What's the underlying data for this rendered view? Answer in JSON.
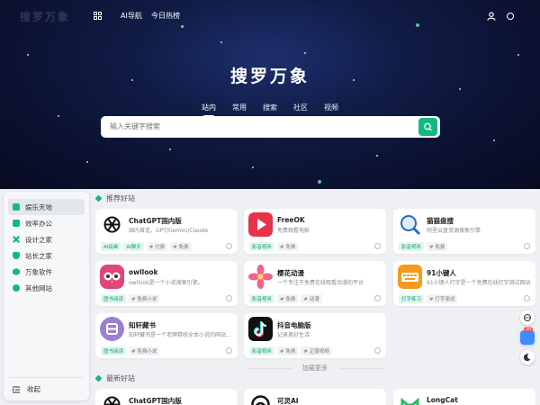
{
  "header": {
    "logo_text": "搜罗万象",
    "nav": [
      "AI导航",
      "今日热榜"
    ]
  },
  "hero": {
    "title": "搜罗万象",
    "tabs": [
      "站内",
      "常用",
      "搜索",
      "社区",
      "视频"
    ],
    "active_tab": "站内",
    "search_placeholder": "输入关键字搜索"
  },
  "sidebar": {
    "items": [
      {
        "label": "娱乐天地",
        "icon": "gamepad-icon",
        "color": "#14b882"
      },
      {
        "label": "效率办公",
        "icon": "briefcase-icon",
        "color": "#14b882"
      },
      {
        "label": "设计之家",
        "icon": "pen-icon",
        "color": "#14b882"
      },
      {
        "label": "站长之家",
        "icon": "shield-icon",
        "color": "#14b882"
      },
      {
        "label": "万象软件",
        "icon": "box-icon",
        "color": "#14b882"
      },
      {
        "label": "其他网站",
        "icon": "more-icon",
        "color": "#14b882"
      }
    ],
    "collapse_label": "收起"
  },
  "recommended": {
    "title": "推荐好站",
    "cards": [
      {
        "name": "ChatGPT国内版",
        "desc": "国内首连，GPT/Gemini/Claude",
        "tags": [
          [
            "AI绘画",
            "green"
          ],
          [
            "AI聊天",
            "green"
          ],
          [
            "# 付费",
            "gray"
          ],
          [
            "# 免费",
            "gray"
          ]
        ],
        "logo": "openai"
      },
      {
        "name": "FreeOK",
        "desc": "免费观看电影",
        "tags": [
          [
            "影音视听",
            "green"
          ],
          [
            "# 免费",
            "gray"
          ]
        ],
        "logo": "freeok"
      },
      {
        "name": "猫猫盘搜",
        "desc": "阿里云盘资源搜索引擎",
        "tags": [
          [
            "影音视听",
            "green"
          ],
          [
            "# 免费",
            "gray"
          ]
        ],
        "logo": "search"
      },
      {
        "name": "owllook",
        "desc": "owllook是一个小说搜索引擎。",
        "tags": [
          [
            "图书阅读",
            "green"
          ],
          [
            "# 免费小说",
            "gray"
          ]
        ],
        "logo": "owl"
      },
      {
        "name": "樱花动漫",
        "desc": "一个专注于免费在线观看动漫的平台",
        "tags": [
          [
            "影音视听",
            "green"
          ],
          [
            "# 免费",
            "gray"
          ],
          [
            "# 动漫",
            "gray"
          ]
        ],
        "logo": "sakura"
      },
      {
        "name": "91小键人",
        "desc": "91小键人打字是一个免费在线打字测试网站...",
        "tags": [
          [
            "打字练习",
            "green"
          ],
          [
            "# 打字测试",
            "gray"
          ]
        ],
        "logo": "typing"
      },
      {
        "name": "知轩藏书",
        "desc": "知轩藏书是一个老牌精校全本小说的网站...",
        "tags": [
          [
            "图书阅读",
            "green"
          ],
          [
            "# 免费小说",
            "gray"
          ]
        ],
        "logo": "zhi"
      },
      {
        "name": "抖音电脑版",
        "desc": "记录美好生活",
        "tags": [
          [
            "影音视听",
            "green"
          ],
          [
            "# 免费",
            "gray"
          ],
          [
            "# 正版视频",
            "gray"
          ]
        ],
        "logo": "douyin"
      }
    ],
    "load_more": "加载更多"
  },
  "latest": {
    "title": "最新好站",
    "cards": [
      {
        "name": "ChatGPT国内版",
        "logo": "openai"
      },
      {
        "name": "可灵AI",
        "logo": "kling"
      },
      {
        "name": "LongCat",
        "logo": "longcat"
      }
    ]
  },
  "float_badge": "20"
}
